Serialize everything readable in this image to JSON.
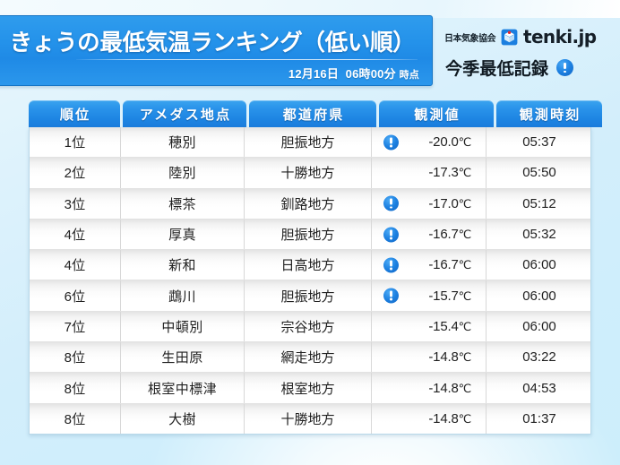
{
  "banner": {
    "title": "きょうの最低気温ランキング（低い順）",
    "timestamp_date": "12月16日",
    "timestamp_time": "06時00分",
    "timestamp_suffix": "時点"
  },
  "brand": {
    "org": "日本気象協会",
    "logo_icon": "tenki-cube-icon",
    "name": "tenki.jp"
  },
  "record_badge": {
    "label": "今季最低記録",
    "icon": "alert-exclamation-icon"
  },
  "table": {
    "columns": [
      {
        "key": "rank",
        "label": "順位"
      },
      {
        "key": "station",
        "label": "アメダス地点"
      },
      {
        "key": "prefecture",
        "label": "都道府県"
      },
      {
        "key": "value",
        "label": "観測値"
      },
      {
        "key": "time",
        "label": "観測時刻"
      }
    ],
    "rows": [
      {
        "rank": "1位",
        "station": "穂別",
        "prefecture": "胆振地方",
        "record": true,
        "temp": "-20.0",
        "unit": "℃",
        "time": "05:37"
      },
      {
        "rank": "2位",
        "station": "陸別",
        "prefecture": "十勝地方",
        "record": false,
        "temp": "-17.3",
        "unit": "℃",
        "time": "05:50"
      },
      {
        "rank": "3位",
        "station": "標茶",
        "prefecture": "釧路地方",
        "record": true,
        "temp": "-17.0",
        "unit": "℃",
        "time": "05:12"
      },
      {
        "rank": "4位",
        "station": "厚真",
        "prefecture": "胆振地方",
        "record": true,
        "temp": "-16.7",
        "unit": "℃",
        "time": "05:32"
      },
      {
        "rank": "4位",
        "station": "新和",
        "prefecture": "日高地方",
        "record": true,
        "temp": "-16.7",
        "unit": "℃",
        "time": "06:00"
      },
      {
        "rank": "6位",
        "station": "鵡川",
        "prefecture": "胆振地方",
        "record": true,
        "temp": "-15.7",
        "unit": "℃",
        "time": "06:00"
      },
      {
        "rank": "7位",
        "station": "中頓別",
        "prefecture": "宗谷地方",
        "record": false,
        "temp": "-15.4",
        "unit": "℃",
        "time": "06:00"
      },
      {
        "rank": "8位",
        "station": "生田原",
        "prefecture": "網走地方",
        "record": false,
        "temp": "-14.8",
        "unit": "℃",
        "time": "03:22"
      },
      {
        "rank": "8位",
        "station": "根室中標津",
        "prefecture": "根室地方",
        "record": false,
        "temp": "-14.8",
        "unit": "℃",
        "time": "04:53"
      },
      {
        "rank": "8位",
        "station": "大樹",
        "prefecture": "十勝地方",
        "record": false,
        "temp": "-14.8",
        "unit": "℃",
        "time": "01:37"
      }
    ]
  },
  "colors": {
    "banner_blue": "#2492ea",
    "header_blue": "#1d84e2",
    "background_cyan": "#d3eefb",
    "text_dark": "#1f1f1f",
    "alert_blue": "#1b7fe0"
  }
}
